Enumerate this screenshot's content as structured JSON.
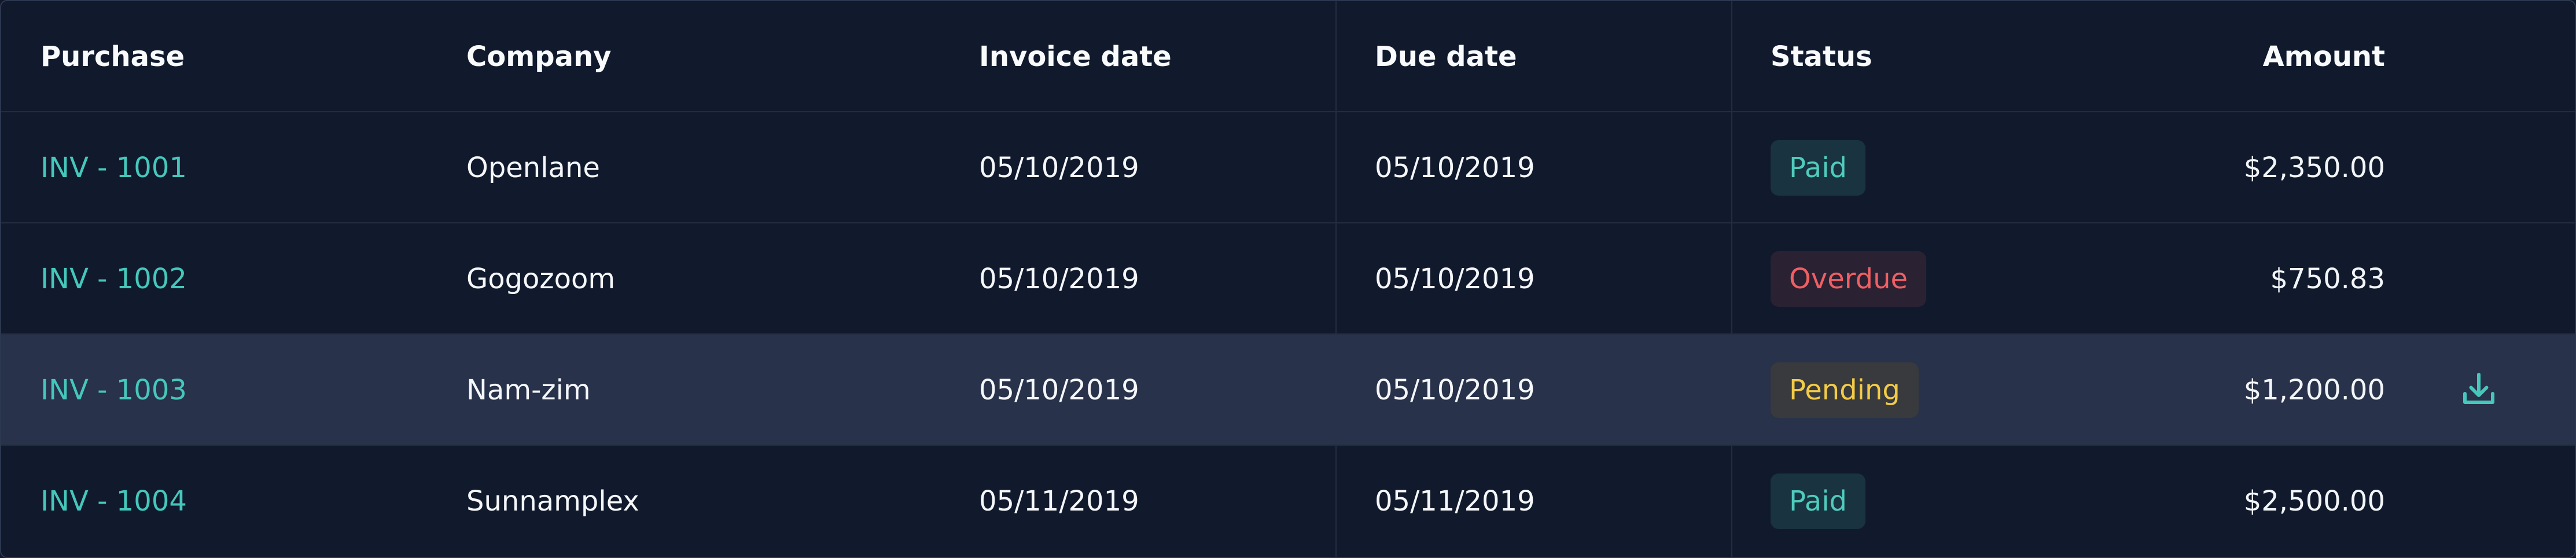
{
  "columns": {
    "purchase": "Purchase",
    "company": "Company",
    "invoice_date": "Invoice date",
    "due_date": "Due date",
    "status": "Status",
    "amount": "Amount"
  },
  "rows": [
    {
      "purchase": "INV - 1001",
      "company": "Openlane",
      "invoice_date": "05/10/2019",
      "due_date": "05/10/2019",
      "status": "Paid",
      "amount": "$2,350.00"
    },
    {
      "purchase": "INV - 1002",
      "company": "Gogozoom",
      "invoice_date": "05/10/2019",
      "due_date": "05/10/2019",
      "status": "Overdue",
      "amount": "$750.83"
    },
    {
      "purchase": "INV - 1003",
      "company": "Nam-zim",
      "invoice_date": "05/10/2019",
      "due_date": "05/10/2019",
      "status": "Pending",
      "amount": "$1,200.00",
      "action_icon": "download-icon"
    },
    {
      "purchase": "INV - 1004",
      "company": "Sunnamplex",
      "invoice_date": "05/11/2019",
      "due_date": "05/11/2019",
      "status": "Paid",
      "amount": "$2,500.00"
    }
  ],
  "colors": {
    "background": "#111a2d",
    "hover_row": "#28324a",
    "link": "#45c8bb",
    "paid": "#50cbbd",
    "overdue": "#f05f63",
    "pending": "#f3cb46"
  }
}
